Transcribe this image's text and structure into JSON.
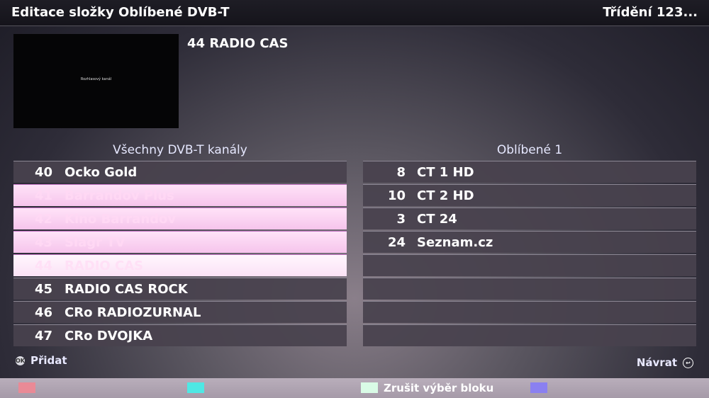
{
  "header": {
    "title": "Editace složky Oblíbené DVB-T",
    "sort": "Třídění 123..."
  },
  "preview": {
    "overlay_text": "Rozhlasový kanál"
  },
  "current_channel": "44 RADIO CAS",
  "left_list": {
    "title": "Všechny DVB-T kanály",
    "rows": [
      {
        "num": "40",
        "name": "Ocko Gold",
        "selected": false
      },
      {
        "num": "41",
        "name": "Barrandov Plus",
        "selected": true
      },
      {
        "num": "42",
        "name": "Kino Barrandov",
        "selected": true
      },
      {
        "num": "43",
        "name": "Slagr TV",
        "selected": true
      },
      {
        "num": "44",
        "name": "RADIO CAS",
        "selected": true
      },
      {
        "num": "45",
        "name": "RADIO CAS ROCK",
        "selected": false
      },
      {
        "num": "46",
        "name": "CRo RADIOZURNAL",
        "selected": false
      },
      {
        "num": "47",
        "name": "CRo DVOJKA",
        "selected": false
      }
    ]
  },
  "right_list": {
    "title": "Oblíbené 1",
    "rows": [
      {
        "num": "8",
        "name": "CT 1 HD"
      },
      {
        "num": "10",
        "name": "CT 2 HD"
      },
      {
        "num": "3",
        "name": "CT 24"
      },
      {
        "num": "24",
        "name": "Seznam.cz"
      },
      {
        "num": "",
        "name": ""
      },
      {
        "num": "",
        "name": ""
      },
      {
        "num": "",
        "name": ""
      },
      {
        "num": "",
        "name": ""
      }
    ]
  },
  "footer": {
    "add_label": "Přidat",
    "add_icon": "ok-button-icon",
    "back_label": "Návrat",
    "back_icon": "return-button-icon",
    "green_key_label": "Zrušit výběr bloku"
  },
  "colors": {
    "red_key": "#e98a96",
    "cyan_key": "#4fe8e4",
    "green_key": "#d9fbe6",
    "blue_key": "#8a80f0",
    "selection": "#f6c4ec"
  }
}
